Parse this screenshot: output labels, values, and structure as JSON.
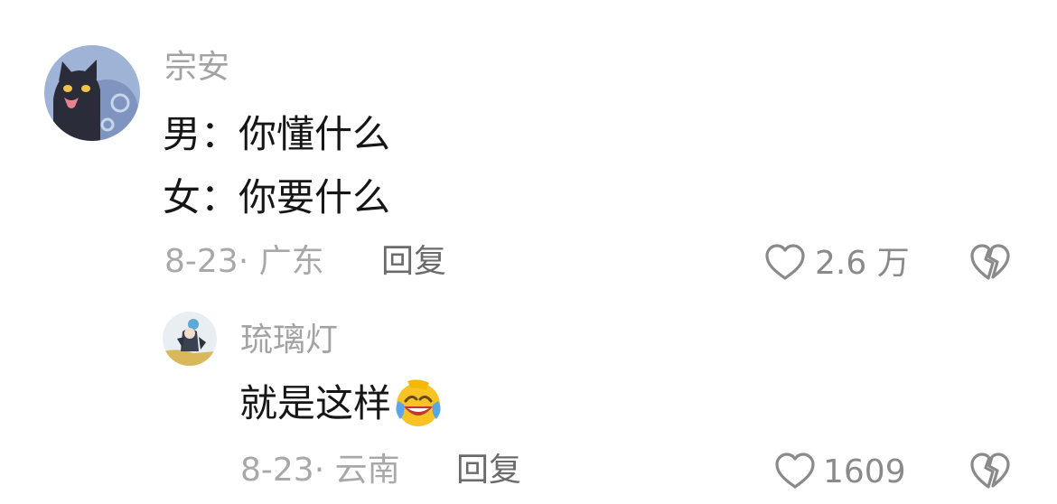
{
  "comments": [
    {
      "username": "宗安",
      "lines": [
        "男：你懂什么",
        "女：你要什么"
      ],
      "date_location": "8-23· 广东",
      "reply_label": "回复",
      "likes": "2.6 万"
    },
    {
      "username": "琉璃灯",
      "text": "就是这样",
      "emoji": "laughing-crying-emoji",
      "date_location": "8-23· 云南",
      "reply_label": "回复",
      "likes": "1609"
    }
  ],
  "icons": {
    "like": "heart-outline-icon",
    "dislike": "broken-heart-outline-icon"
  },
  "colors": {
    "username": "#a3a3a3",
    "text": "#161616",
    "meta": "#a8a8a8",
    "reply": "#6b6b6b",
    "icon": "#8a8a8a"
  }
}
